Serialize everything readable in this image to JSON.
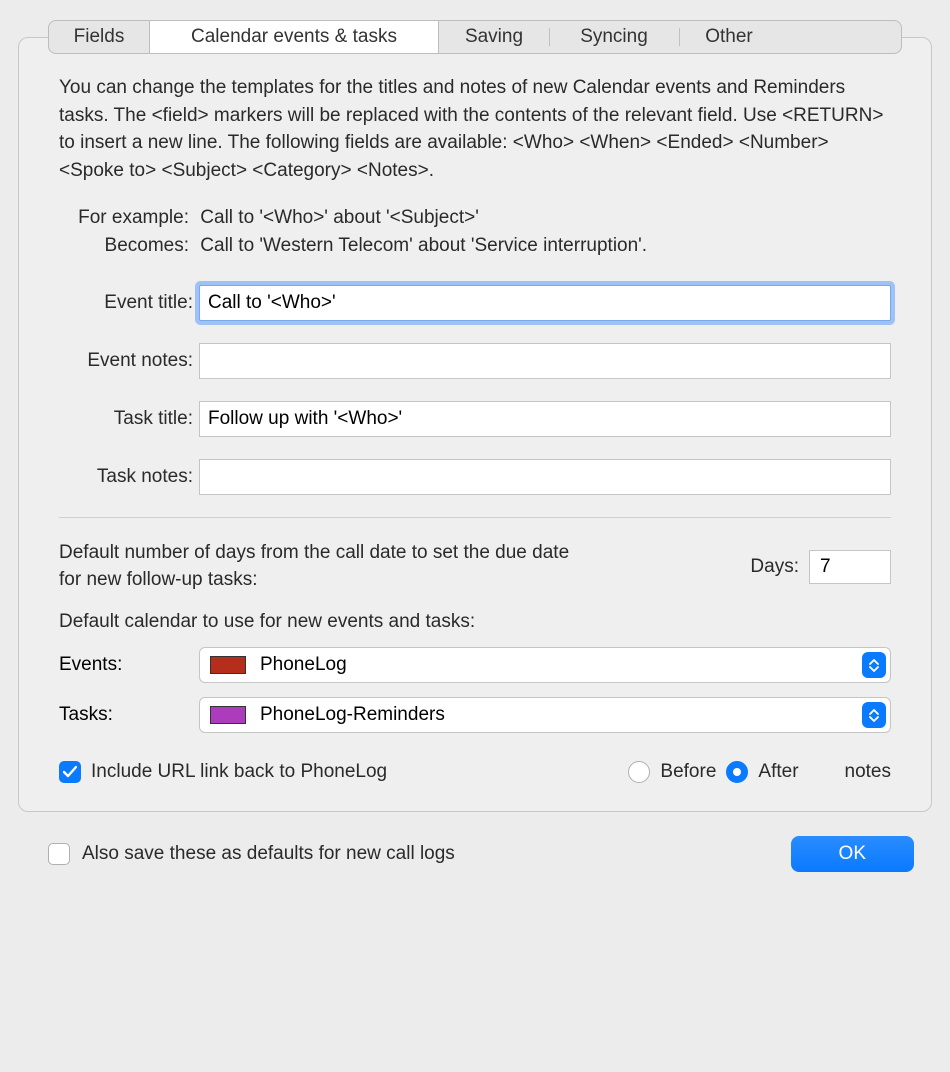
{
  "tabs": {
    "fields": "Fields",
    "calendar": "Calendar events & tasks",
    "saving": "Saving",
    "syncing": "Syncing",
    "other": "Other"
  },
  "description": "You can change the templates for the titles and notes of new Calendar events and Reminders tasks. The <field> markers will be replaced with the contents of the relevant field. Use <RETURN> to insert a new line. The following fields are available: <Who> <When> <Ended> <Number> <Spoke to> <Subject> <Category> <Notes>.",
  "example": {
    "for_label": "For example:",
    "for_value": "Call to '<Who>' about '<Subject>'",
    "becomes_label": "Becomes:",
    "becomes_value": "Call to 'Western Telecom' about 'Service interruption'."
  },
  "labels": {
    "event_title": "Event title:",
    "event_notes": "Event notes:",
    "task_title": "Task title:",
    "task_notes": "Task notes:",
    "days": "Days:",
    "events": "Events:",
    "tasks": "Tasks:",
    "before": "Before",
    "after": "After",
    "notes_suffix": "notes"
  },
  "values": {
    "event_title": "Call to '<Who>'",
    "event_notes": "",
    "task_title": "Follow up with '<Who>'",
    "task_notes": "",
    "days": "7",
    "events_calendar": "PhoneLog",
    "tasks_calendar": "PhoneLog-Reminders"
  },
  "colors": {
    "events_swatch": "#b52e1c",
    "tasks_swatch": "#ad3cbd",
    "accent": "#0a7aff"
  },
  "due_text": "Default number of days from the call date to set the due date for new follow-up tasks:",
  "cal_default_text": "Default calendar to use for new events and tasks:",
  "include_url_label": "Include URL link back to PhoneLog",
  "also_save_label": "Also save these as defaults for new call logs",
  "ok_label": "OK"
}
